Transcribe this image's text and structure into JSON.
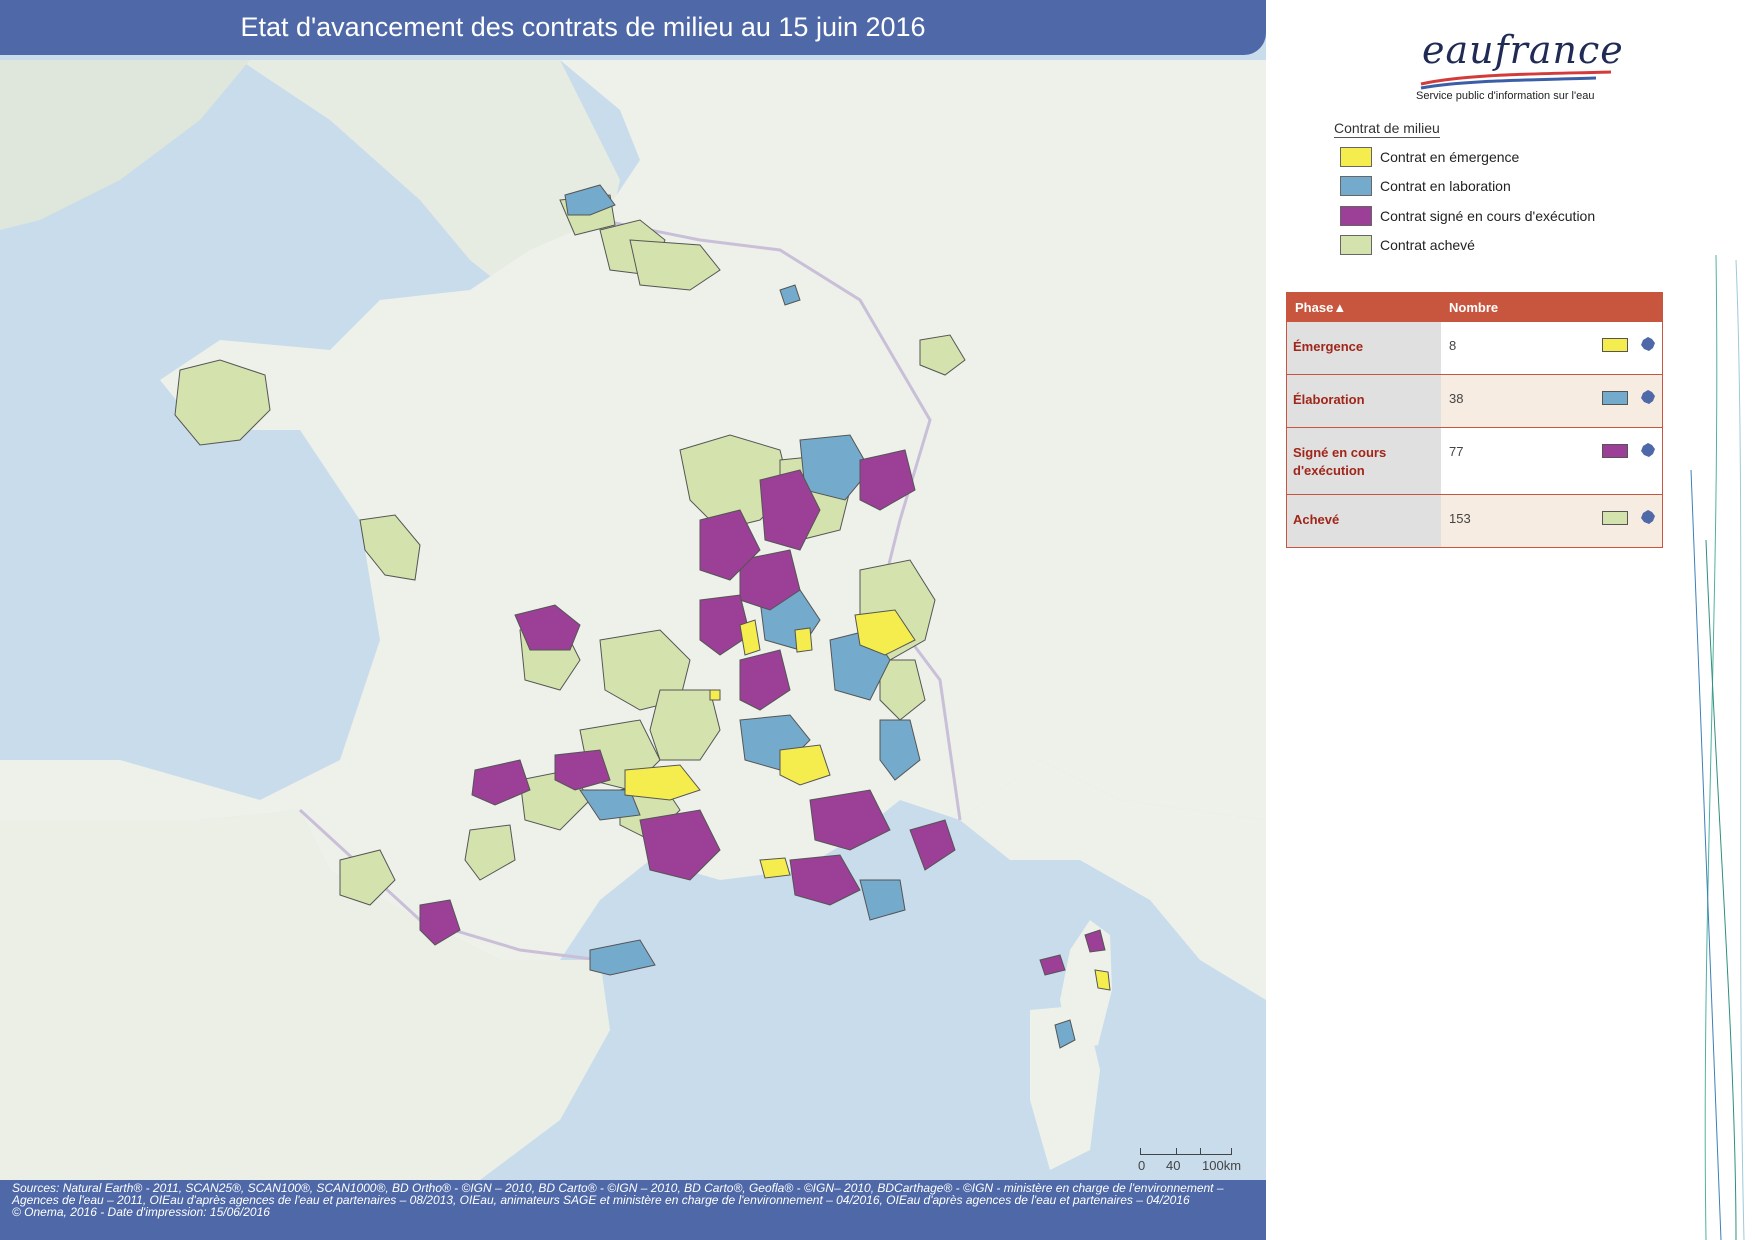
{
  "title": "Etat d'avancement des contrats de milieu au 15 juin 2016",
  "logo": {
    "word": "eaufrance",
    "tagline": "Service public d'information sur l'eau"
  },
  "legend": {
    "title": "Contrat de milieu",
    "items": [
      {
        "label": "Contrat en émergence",
        "color": "#f5ec4e"
      },
      {
        "label": "Contrat en laboration",
        "color": "#74aacb"
      },
      {
        "label": "Contrat signé en cours d'exécution",
        "color": "#9b3f97"
      },
      {
        "label": "Contrat achevé",
        "color": "#d4e2ae"
      }
    ]
  },
  "table": {
    "header_phase": "Phase",
    "header_count": "Nombre",
    "rows": [
      {
        "phase": "Émergence",
        "count": "8",
        "color": "#f5ec4e"
      },
      {
        "phase": "Élaboration",
        "count": "38",
        "color": "#74aacb"
      },
      {
        "phase": "Signé en cours d'exécution",
        "count": "77",
        "color": "#9b3f97"
      },
      {
        "phase": "Achevé",
        "count": "153",
        "color": "#d4e2ae"
      }
    ]
  },
  "scale": {
    "labels": [
      "0",
      "40",
      "100km"
    ]
  },
  "footer": {
    "line1": "Sources: Natural Earth® - 2011, SCAN25®, SCAN100®, SCAN1000®, BD Ortho® - ©IGN – 2010, BD Carto® - ©IGN – 2010, BD Carto®, Geofla® - ©IGN– 2010, BDCarthage® - ©IGN - ministère en charge de l'environnement – Agences de l'eau – 2011, OIEau d'après agences de l'eau et partenaires – 08/2013, OIEau, animateurs SAGE et ministère en charge de l'environnement – 04/2016, OIEau d'après agences de l'eau et partenaires – 04/2016",
    "line2": "© Onema, 2016 - Date d'impression: 15/06/2016"
  },
  "colors": {
    "sea": "#c9dceb",
    "land": "#eef1ea",
    "banner": "#4f69a8",
    "table_header": "#c8553d"
  },
  "map_regions": [
    {
      "status": "emergence",
      "count": 8
    },
    {
      "status": "elaboration",
      "count": 38
    },
    {
      "status": "signe",
      "count": 77
    },
    {
      "status": "acheve",
      "count": 153
    }
  ]
}
